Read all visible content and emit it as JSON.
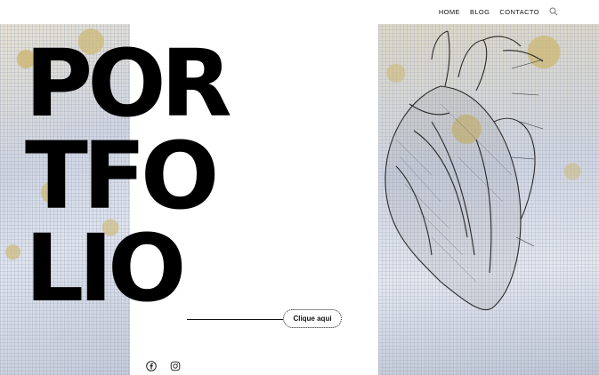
{
  "nav": {
    "items": [
      {
        "label": "HOME"
      },
      {
        "label": "BLOG"
      },
      {
        "label": "CONTACTO"
      }
    ],
    "search_icon": "search-icon"
  },
  "hero": {
    "title_lines": [
      "POR",
      "TFO",
      "LIO"
    ]
  },
  "cta": {
    "label": "Clique aqui"
  },
  "social": {
    "icons": [
      "facebook-icon",
      "instagram-icon"
    ]
  },
  "colors": {
    "text": "#000000",
    "accent": "#c9b271",
    "background": "#ffffff"
  }
}
